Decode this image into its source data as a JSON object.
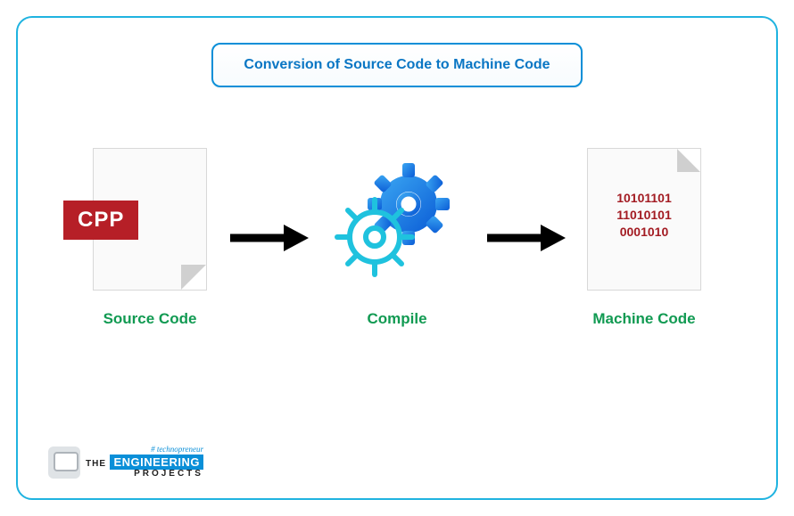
{
  "title": "Conversion of Source Code to Machine Code",
  "stages": {
    "source": {
      "badge": "CPP",
      "label": "Source Code"
    },
    "compile": {
      "label": "Compile"
    },
    "machine": {
      "label": "Machine Code",
      "lines": [
        "10101101",
        "11010101",
        "0001010"
      ]
    }
  },
  "logo": {
    "tag": "# technopreneur",
    "line1": "THE",
    "line2": "ENGINEERING",
    "line3": "PROJECTS"
  }
}
